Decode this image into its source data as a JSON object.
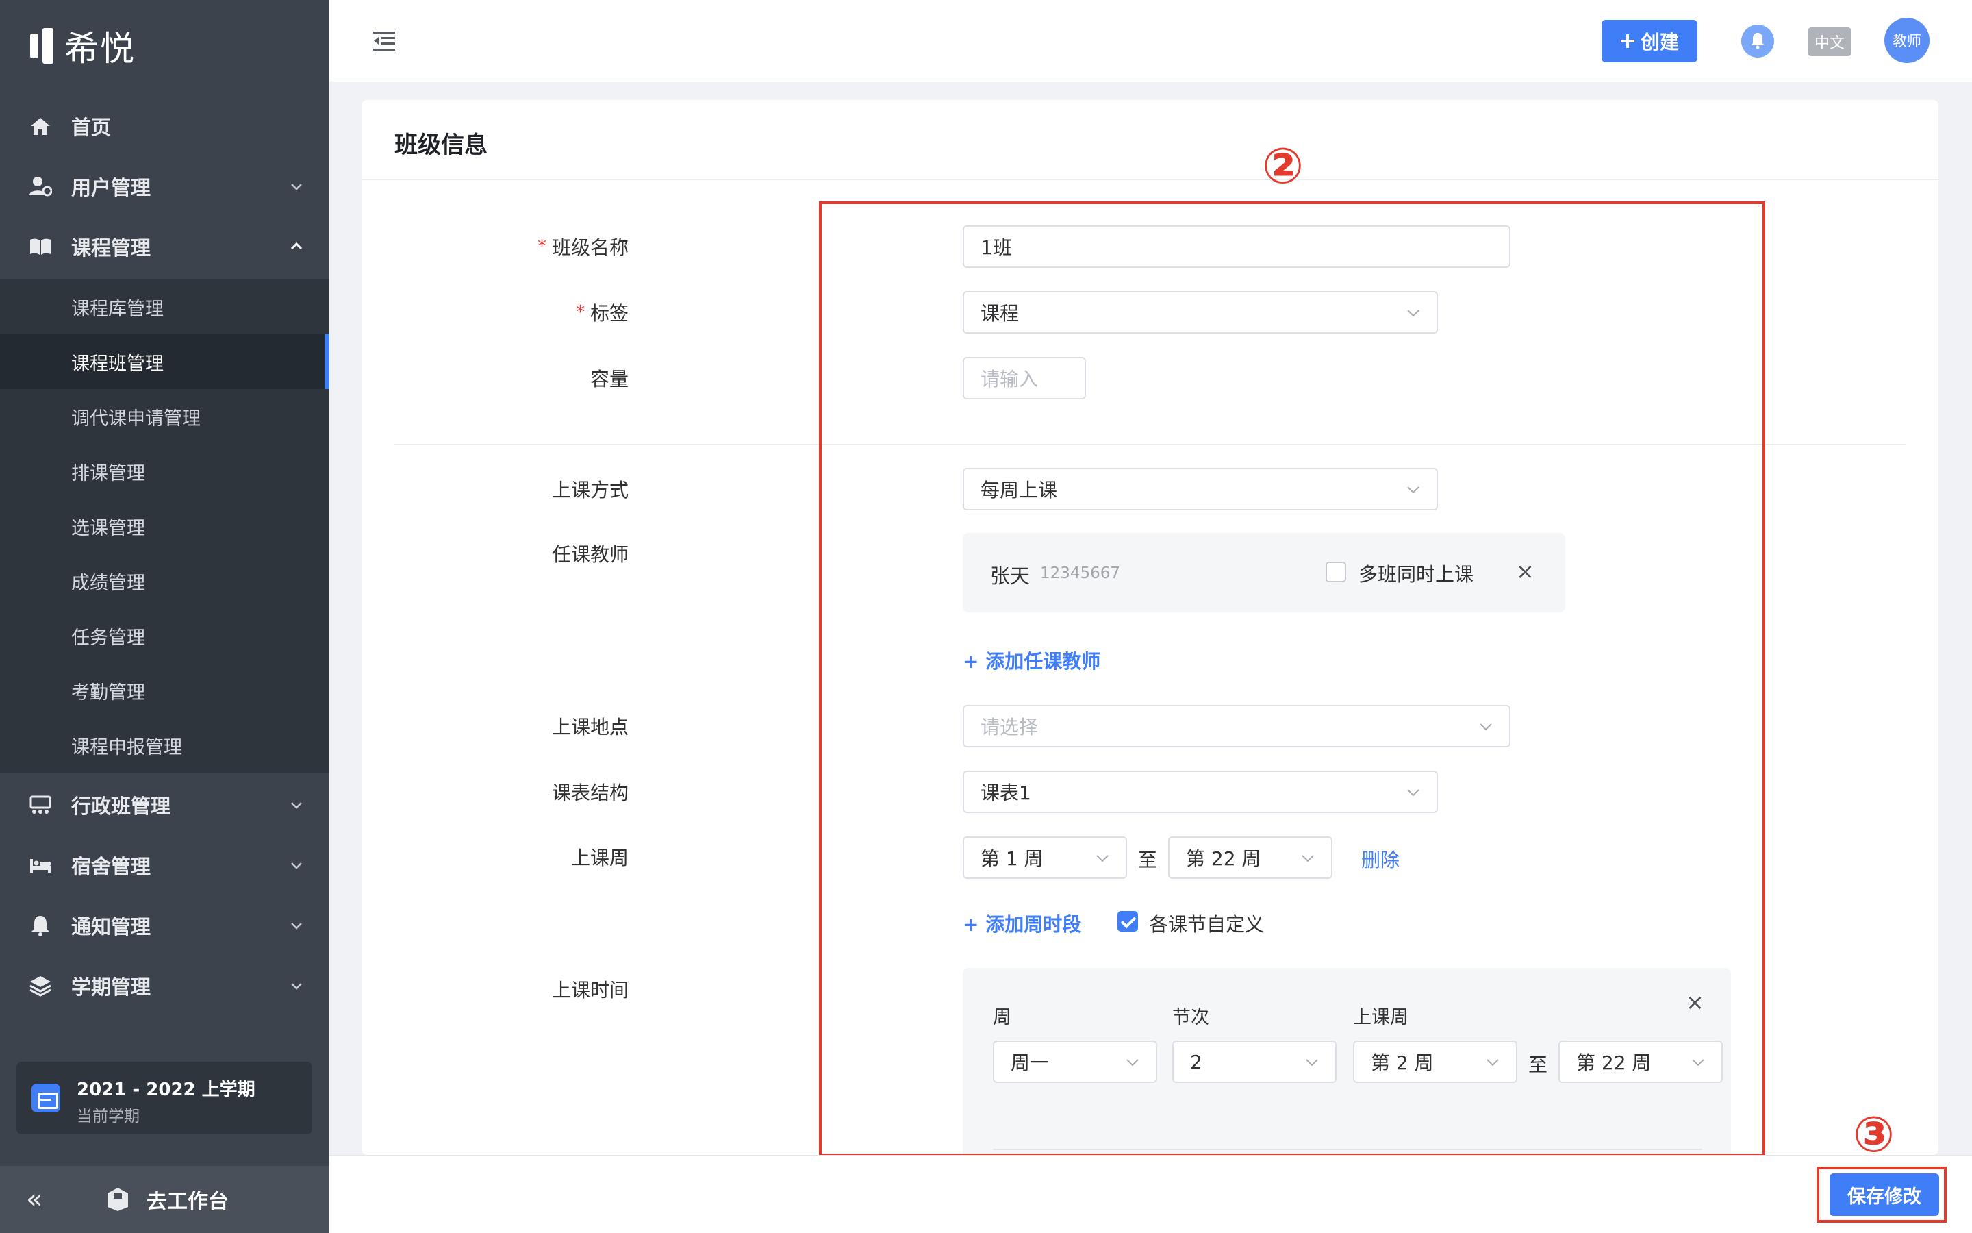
{
  "app": {
    "logo_text": "希悦"
  },
  "sidebar": {
    "items": [
      {
        "label": "首页",
        "icon": "home-icon"
      },
      {
        "label": "用户管理",
        "icon": "user-manage-icon"
      },
      {
        "label": "课程管理",
        "icon": "book-icon"
      },
      {
        "label": "行政班管理",
        "icon": "class-icon"
      },
      {
        "label": "宿舍管理",
        "icon": "bed-icon"
      },
      {
        "label": "通知管理",
        "icon": "bell-icon"
      },
      {
        "label": "学期管理",
        "icon": "layers-icon"
      }
    ],
    "sub_items": [
      {
        "label": "课程库管理",
        "active": false
      },
      {
        "label": "课程班管理",
        "active": true
      },
      {
        "label": "调代课申请管理",
        "active": false
      },
      {
        "label": "排课管理",
        "active": false
      },
      {
        "label": "选课管理",
        "active": false
      },
      {
        "label": "成绩管理",
        "active": false
      },
      {
        "label": "任务管理",
        "active": false
      },
      {
        "label": "考勤管理",
        "active": false
      },
      {
        "label": "课程申报管理",
        "active": false
      }
    ],
    "semester": {
      "title": "2021 - 2022 上学期",
      "subtitle": "当前学期"
    },
    "footer": {
      "collapse": "«",
      "workbench": "去工作台"
    }
  },
  "header": {
    "create_label": "创建",
    "lang": "中文",
    "avatar": "教师"
  },
  "card": {
    "title": "班级信息",
    "form": {
      "class_name_label": "班级名称",
      "class_name_value": "1班",
      "tag_label": "标签",
      "tag_value": "课程",
      "capacity_label": "容量",
      "capacity_placeholder": "请输入",
      "mode_label": "上课方式",
      "mode_value": "每周上课",
      "teacher_label": "任课教师",
      "teacher_name": "张天",
      "teacher_id": "12345667",
      "multi_class_label": "多班同时上课",
      "add_teacher": "添加任课教师",
      "location_label": "上课地点",
      "location_placeholder": "请选择",
      "structure_label": "课表结构",
      "structure_value": "课表1",
      "weeks_label": "上课周",
      "week_start": "第 1 周",
      "to": "至",
      "week_end": "第 22 周",
      "delete": "删除",
      "add_week_period": "添加周时段",
      "custom_sections_label": "各课节自定义",
      "time_label": "上课时间",
      "time_cols": {
        "day": "周",
        "section": "节次",
        "weeks": "上课周"
      },
      "time_row": {
        "day": "周一",
        "section": "2",
        "week_start": "第 2 周",
        "week_end": "第 22 周"
      }
    }
  },
  "annotations": {
    "box2": "②",
    "box3": "③"
  },
  "footer_bar": {
    "save_label": "保存修改"
  },
  "colors": {
    "primary": "#3f7ef7",
    "sidebar": "#3d434c",
    "annotation": "#e23b2e"
  }
}
